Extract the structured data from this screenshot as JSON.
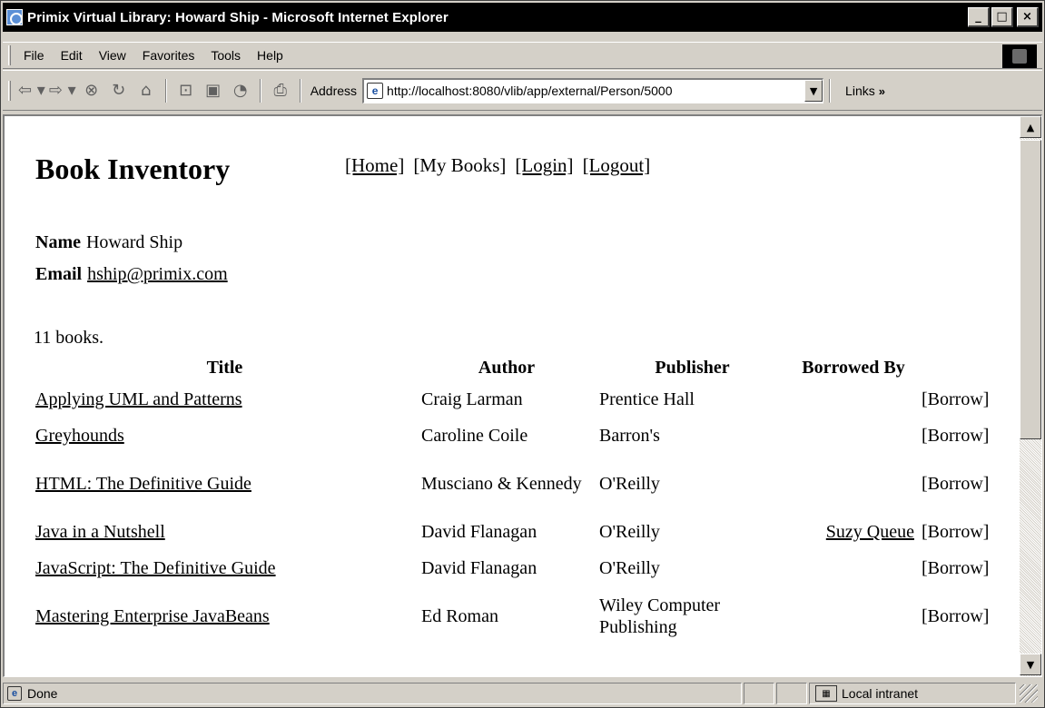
{
  "window": {
    "title": "Primix Virtual Library: Howard Ship - Microsoft Internet Explorer",
    "minimize": "_",
    "maximize": "□",
    "close": "×"
  },
  "menu": {
    "items": [
      "File",
      "Edit",
      "View",
      "Favorites",
      "Tools",
      "Help"
    ]
  },
  "toolbar": {
    "address_label": "Address",
    "url": "http://localhost:8080/vlib/app/external/Person/5000",
    "links_label": "Links",
    "links_chevron": "»"
  },
  "page": {
    "heading": "Book Inventory",
    "nav": [
      "[Home]",
      "[My Books]",
      "[Login]",
      "[Logout]"
    ],
    "name_label": "Name",
    "name_value": "Howard Ship",
    "email_label": "Email",
    "email_value": "hship@primix.com",
    "count_text": "11 books.",
    "table": {
      "headers": [
        "Title",
        "Author",
        "Publisher",
        "Borrowed By",
        ""
      ],
      "rows": [
        {
          "title": "Applying UML and Patterns",
          "author": "Craig Larman",
          "publisher": "Prentice Hall",
          "borrowed_by": "",
          "action": "[Borrow]"
        },
        {
          "title": "Greyhounds",
          "author": "Caroline Coile",
          "publisher": "Barron's",
          "borrowed_by": "",
          "action": "[Borrow]"
        },
        {
          "title": "HTML: The Definitive Guide",
          "author": "Musciano & Kennedy",
          "publisher": "O'Reilly",
          "borrowed_by": "",
          "action": "[Borrow]"
        },
        {
          "title": "Java in a Nutshell",
          "author": "David Flanagan",
          "publisher": "O'Reilly",
          "borrowed_by": "Suzy Queue",
          "action": "[Borrow]"
        },
        {
          "title": "JavaScript: The Definitive Guide",
          "author": "David Flanagan",
          "publisher": "O'Reilly",
          "borrowed_by": "",
          "action": "[Borrow]"
        },
        {
          "title": "Mastering Enterprise JavaBeans",
          "author": "Ed Roman",
          "publisher": "Wiley Computer Publishing",
          "borrowed_by": "",
          "action": "[Borrow]"
        }
      ]
    }
  },
  "status": {
    "text": "Done",
    "zone": "Local intranet"
  }
}
